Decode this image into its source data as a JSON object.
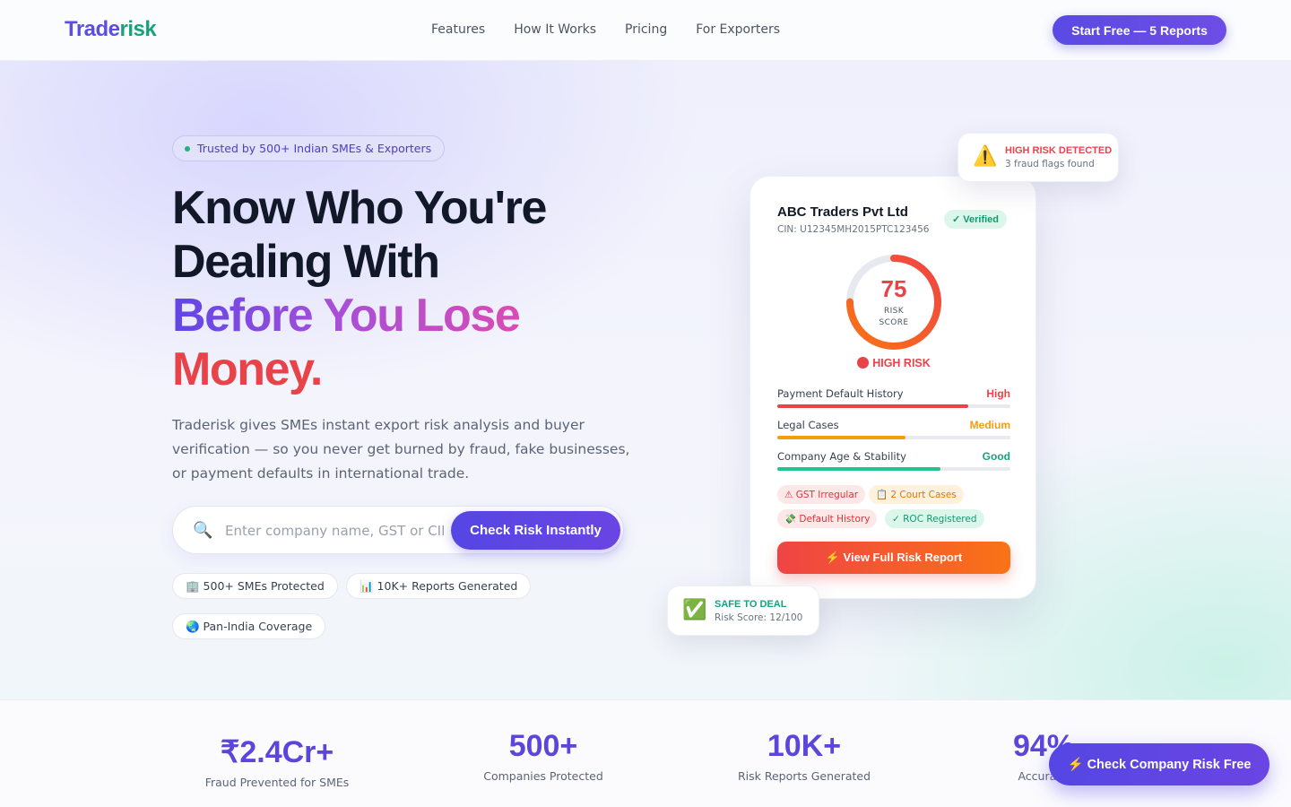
{
  "brand": {
    "part1": "Trade",
    "part2": "risk"
  },
  "nav": {
    "links": [
      "Features",
      "How It Works",
      "Pricing",
      "For Exporters"
    ],
    "cta": "Start Free — 5 Reports"
  },
  "hero": {
    "trust_badge": "Trusted by 500+ Indian SMEs & Exporters",
    "headline_line1": "Know Who You're",
    "headline_line2": "Dealing With",
    "headline_line3": "Before You Lose",
    "headline_line4": "Money.",
    "subtext": "Traderisk gives SMEs instant export risk analysis and buyer verification — so you never get burned by fraud, fake businesses, or payment defaults in international trade.",
    "search_placeholder": "Enter company name, GST or CIN",
    "search_button": "Check Risk Instantly",
    "stat_pills": [
      "🏢 500+ SMEs Protected",
      "📊 10K+ Reports Generated",
      "🌏 Pan-India Coverage"
    ]
  },
  "card": {
    "company_name": "ABC Traders Pvt Ltd",
    "cin": "CIN: U12345MH2015PTC123456",
    "verified": "✓ Verified",
    "score": "75",
    "score_max": 100,
    "score_label_line1": "RISK",
    "score_label_line2": "SCORE",
    "risk_level": "HIGH RISK",
    "metrics": [
      {
        "name": "Payment Default History",
        "value": "High",
        "level": 0.82,
        "color": "#e9434a"
      },
      {
        "name": "Legal Cases",
        "value": "Medium",
        "level": 0.55,
        "color": "#f59e0b"
      },
      {
        "name": "Company Age & Stability",
        "value": "Good",
        "level": 0.7,
        "color": "#22c38e"
      }
    ],
    "tags": [
      {
        "label": "⚠ GST Irregular",
        "tone": "red"
      },
      {
        "label": "📋 2 Court Cases",
        "tone": "amber"
      },
      {
        "label": "💸 Default History",
        "tone": "red"
      },
      {
        "label": "✓ ROC Registered",
        "tone": "green"
      }
    ],
    "button": "⚡ View Full Risk Report"
  },
  "alert_high": {
    "icon": "⚠️",
    "title": "HIGH RISK DETECTED",
    "subtitle": "3 fraud flags found"
  },
  "alert_safe": {
    "icon": "✅",
    "title": "SAFE TO DEAL",
    "subtitle": "Risk Score: 12/100"
  },
  "stats": [
    {
      "value": "₹2.4Cr+",
      "label": "Fraud Prevented for SMEs"
    },
    {
      "value": "500+",
      "label": "Companies Protected"
    },
    {
      "value": "10K+",
      "label": "Risk Reports Generated"
    },
    {
      "value": "94%",
      "label": "Accuracy"
    }
  ],
  "fab": "⚡ Check Company Risk Free",
  "colors": {
    "primary": "#5b46db",
    "danger": "#e9434a",
    "success": "#16a37b",
    "warning": "#f59e0b"
  }
}
